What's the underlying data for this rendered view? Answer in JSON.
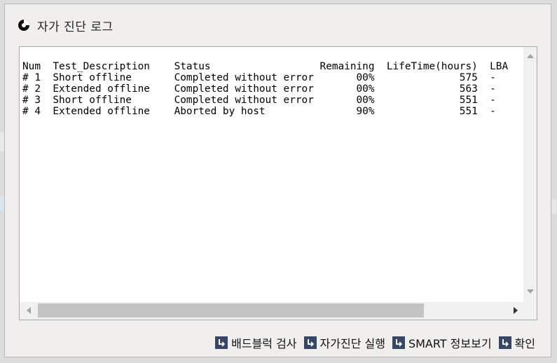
{
  "dialog": {
    "title": "자가 진단 로그",
    "title_icon": "disk-icon",
    "log_lines": [
      "Num  Test_Description    Status                  Remaining  LifeTime(hours)  LBA",
      "# 1  Short offline       Completed without error       00%              575  -",
      "# 2  Extended offline    Completed without error       00%              563  -",
      "# 3  Short offline       Completed without error       00%              551  -",
      "# 4  Extended offline    Aborted by host               90%              551  -"
    ],
    "buttons": [
      {
        "label": "배드블럭 검사",
        "icon": "arrow-return-icon"
      },
      {
        "label": "자가진단 실행",
        "icon": "arrow-return-icon"
      },
      {
        "label": "SMART 정보보기",
        "icon": "arrow-return-icon"
      },
      {
        "label": "확인",
        "icon": "arrow-return-icon"
      }
    ]
  },
  "colors": {
    "button_icon": "#34476a",
    "dialog_bg": "#f0efee"
  }
}
